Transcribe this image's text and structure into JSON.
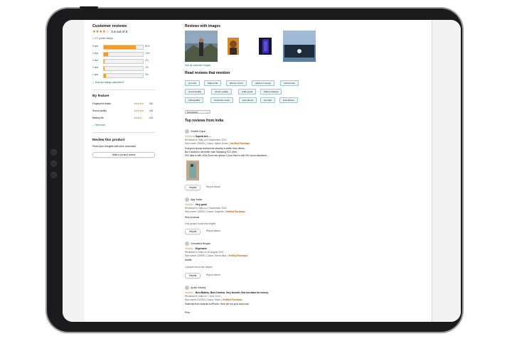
{
  "ratings": {
    "title": "Customer reviews",
    "stars": "★★★★☆",
    "average": "4.6 out of 5",
    "global": "1,107 global ratings",
    "bars": [
      {
        "label": "5 star",
        "pct": "81%",
        "value": 81
      },
      {
        "label": "4 star",
        "pct": "10%",
        "value": 10
      },
      {
        "label": "3 star",
        "pct": "2%",
        "value": 2
      },
      {
        "label": "2 star",
        "pct": "1%",
        "value": 1
      },
      {
        "label": "1 star",
        "pct": "5%",
        "value": 5
      }
    ],
    "how_link": "How are ratings calculated?"
  },
  "by_feature": {
    "title": "By feature",
    "items": [
      {
        "name": "Fingerprint reader",
        "stars": "★★★★★",
        "score": "4.6"
      },
      {
        "name": "Sound quality",
        "stars": "★★★★★",
        "score": "4.6"
      },
      {
        "name": "Battery life",
        "stars": "★★★★☆",
        "score": "4.5"
      }
    ],
    "see_more": "See more"
  },
  "review_product": {
    "title": "Review this product",
    "subtitle": "Share your thoughts with other customers",
    "button": "Write a product review"
  },
  "images": {
    "title": "Reviews with images",
    "see_all": "See all customer images"
  },
  "mentions": {
    "title": "Read reviews that mention",
    "chips": [
      "pro max",
      "battery life",
      "iphone 13 pro",
      "value for money",
      "refresh rate",
      "sound quality",
      "picture quality",
      "really good",
      "battery backup",
      "build quality",
      "cinematic mode",
      "best phone",
      "low light",
      "best iphone"
    ]
  },
  "sort": {
    "label": "Top reviews"
  },
  "top_reviews_title": "Top reviews from India",
  "reviews": [
    {
      "author": "Vineeth Gopal",
      "stars": "★★★★★",
      "headline": "Superb bet......",
      "meta": "Reviewed in India on 5 September 2022",
      "variant": "Size name: 256GB | Colour: Alpine Green",
      "verified": "Verified Purchase",
      "body": [
        "Everyone knows that iphone security is better than others...",
        "But Camera is not better than Samsung S22 Ultra ...",
        "S22 ultra is with 100x Zoom but iphone 13 pro Max is with 20x zoom maximum...."
      ],
      "helpful_text": "",
      "helpful": "Helpful",
      "report": "Report abuse"
    },
    {
      "author": "Ajay Yadav",
      "stars": "★★★★☆",
      "headline": "Very good",
      "meta": "Reviewed in India on 2 September 2022",
      "variant": "Size name: 128GB | Colour: Graphite",
      "verified": "Verified Purchase",
      "body": [
        "Nice products"
      ],
      "helpful_text": "One person found this helpful",
      "helpful": "Helpful",
      "report": "Report abuse"
    },
    {
      "author": "Chinudeha Bhoyan",
      "stars": "★★★★☆",
      "headline": "Expensive",
      "meta": "Reviewed in India on 26 August 2022",
      "variant": "Size name: 128GB | Colour: Sierra Blue",
      "verified": "Verified Purchase",
      "body": [
        "Mobile"
      ],
      "helpful_text": "4 people found this helpful",
      "helpful": "Helpful",
      "report": "Report abuse"
    },
    {
      "author": "Ayush Kamboj",
      "stars": "★★★★☆",
      "headline": "Best Battery. Best Camera. Very smooth. But not value for money.",
      "meta": "Reviewed in India on 7 June 2022",
      "variant": "Size name: 512GB | Colour: Silver",
      "verified": "Verified Purchase",
      "body": [
        "Switched from Android to iPhone. Here are my pros and cons.",
        "",
        "Pros:"
      ],
      "helpful_text": "",
      "helpful": "",
      "report": ""
    }
  ]
}
